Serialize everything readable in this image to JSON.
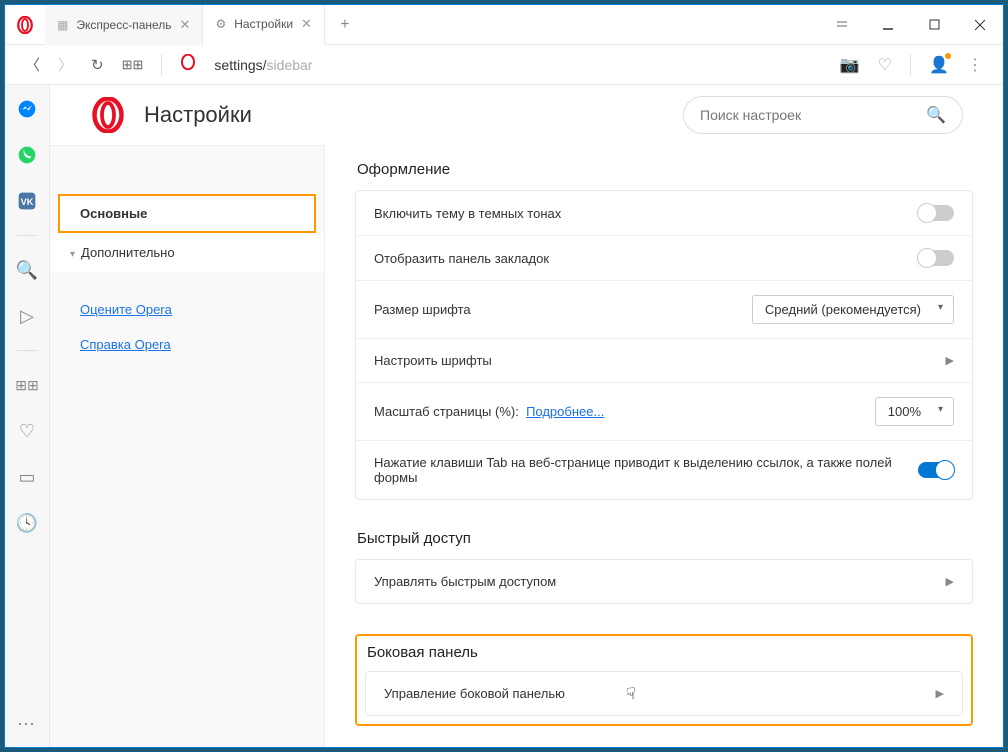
{
  "tabs": {
    "t1": "Экспресс-панель",
    "t2": "Настройки"
  },
  "address": {
    "prefix": "settings/",
    "suffix": "sidebar"
  },
  "header": {
    "title": "Настройки",
    "search_ph": "Поиск настроек"
  },
  "nav": {
    "primary": "Основные",
    "advanced": "Дополнительно",
    "rate": "Оцените Opera",
    "help": "Справка Opera"
  },
  "sections": {
    "appearance": {
      "title": "Оформление",
      "dark": "Включить тему в темных тонах",
      "bookmarks": "Отобразить панель закладок",
      "fontsize": "Размер шрифта",
      "fontsize_val": "Средний (рекомендуется)",
      "customfonts": "Настроить шрифты",
      "zoom": "Масштаб страницы (%):",
      "zoom_more": "Подробнее...",
      "zoom_val": "100%",
      "tab": "Нажатие клавиши Tab на веб-странице приводит к выделению ссылок, а также полей формы"
    },
    "quick": {
      "title": "Быстрый доступ",
      "manage": "Управлять быстрым доступом"
    },
    "side": {
      "title": "Боковая панель",
      "manage": "Управление боковой панелью"
    }
  }
}
